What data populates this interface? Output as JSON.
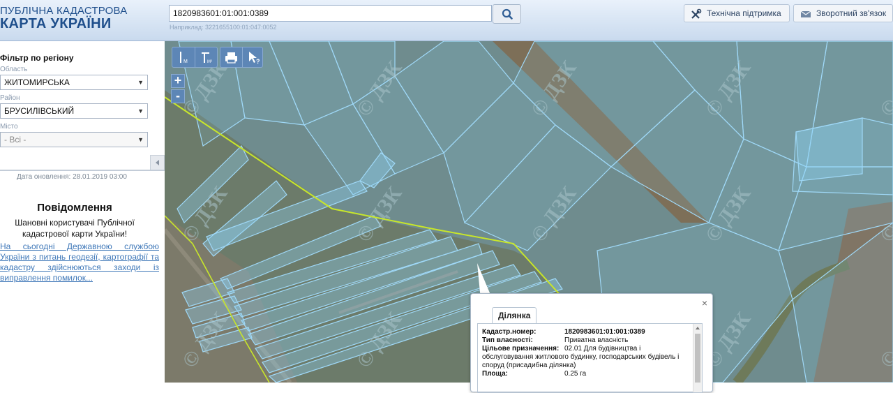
{
  "header": {
    "brand_line1": "ПУБЛІЧНА КАДАСТРОВА",
    "brand_line2": "КАРТА УКРАЇНИ",
    "search_value": "1820983601:01:001:0389",
    "search_hint": "Наприклад: 3221655100:01:047:0052",
    "support_label": "Технічна підтримка",
    "feedback_label": "Зворотний зв'язок",
    "search_icon": "search-icon",
    "support_icon": "tools-icon",
    "feedback_icon": "envelope-icon"
  },
  "sidebar": {
    "filter_title": "Фільтр по регіону",
    "oblast_label": "Область",
    "oblast_value": "ЖИТОМИРСЬКА",
    "rayon_label": "Район",
    "rayon_value": "БРУСИЛІВСЬКИЙ",
    "city_label": "Місто",
    "city_value": "- Всі -",
    "updated": "Дата оновлення: 28.01.2019 03:00",
    "notice_title": "Повідомлення",
    "notice_text": "Шановні користувачі Публічної кадастрової карти України!",
    "notice_link": "На сьогодні Державною службою України з питань геодезії, картографії та кадастру здійснюються заходи із виправлення помилок..."
  },
  "map": {
    "watermark": "© ДЗК",
    "zoom_in": "+",
    "zoom_out": "-",
    "tools": [
      "ruler-m-icon",
      "ruler-area-icon",
      "print-icon",
      "identify-icon"
    ]
  },
  "popup": {
    "tab": "Ділянка",
    "rows": [
      {
        "key": "Кадастр.номер:",
        "value": "1820983601:01:001:0389"
      },
      {
        "key": "Тип власності:",
        "value": "Приватна власність"
      },
      {
        "key": "Цільове призначення:",
        "value": "02.01 Для будівництва і"
      },
      {
        "key": "",
        "value": "обслуговування житлового будинку, господарських будівель і споруд (присадибна ділянка)"
      },
      {
        "key": "Площа:",
        "value": "0.25 га"
      }
    ],
    "close": "×"
  },
  "colors": {
    "brand": "#1f4f8c",
    "parcel_fill": "#8fd4f5",
    "boundary": "#c8e62a",
    "link": "#3e77b8"
  }
}
